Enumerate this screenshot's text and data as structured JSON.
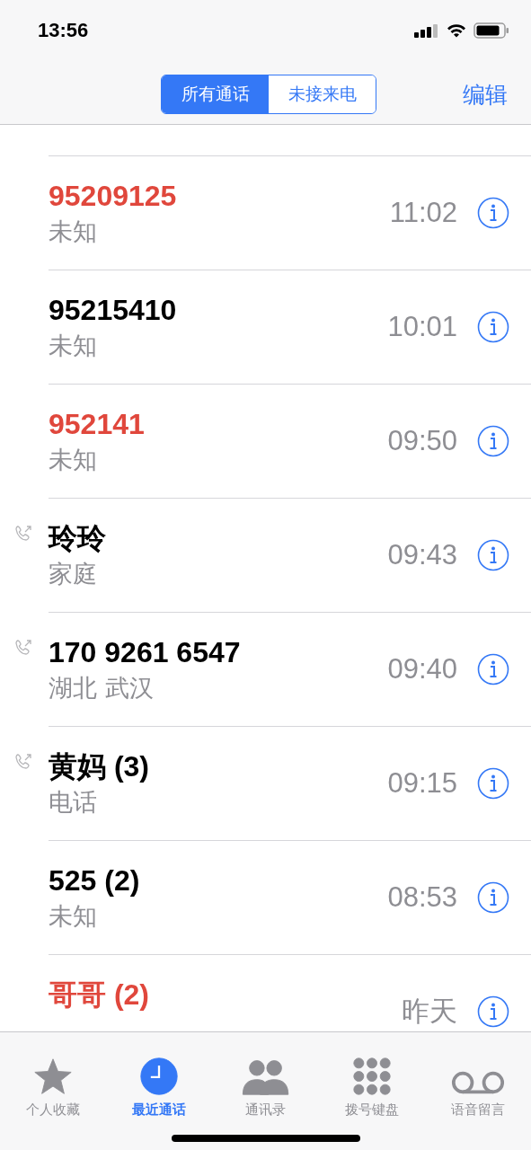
{
  "status_bar": {
    "time": "13:56"
  },
  "nav": {
    "segments": [
      {
        "label": "所有通话",
        "selected": true
      },
      {
        "label": "未接来电",
        "selected": false
      }
    ],
    "edit": "编辑"
  },
  "calls": [
    {
      "name": "95209125",
      "detail": "未知",
      "time": "11:02",
      "missed": true,
      "outgoing": false
    },
    {
      "name": "95215410",
      "detail": "未知",
      "time": "10:01",
      "missed": false,
      "outgoing": false
    },
    {
      "name": "952141",
      "detail": "未知",
      "time": "09:50",
      "missed": true,
      "outgoing": false
    },
    {
      "name": "玲玲",
      "detail": "家庭",
      "time": "09:43",
      "missed": false,
      "outgoing": true
    },
    {
      "name": "170 9261 6547",
      "detail": "湖北 武汉",
      "time": "09:40",
      "missed": false,
      "outgoing": true
    },
    {
      "name": "黄妈 (3)",
      "detail": "电话",
      "time": "09:15",
      "missed": false,
      "outgoing": true
    },
    {
      "name": "525 (2)",
      "detail": "未知",
      "time": "08:53",
      "missed": false,
      "outgoing": false
    },
    {
      "name": "哥哥 (2)",
      "time": "昨天",
      "missed": true,
      "outgoing": false
    }
  ],
  "tab_bar": [
    {
      "kind": "star",
      "label": "个人收藏",
      "selected": false
    },
    {
      "kind": "clock",
      "label": "最近通话",
      "selected": true
    },
    {
      "kind": "people",
      "label": "通讯录",
      "selected": false
    },
    {
      "kind": "keypad",
      "label": "拨号键盘",
      "selected": false
    },
    {
      "kind": "voicemail",
      "label": "语音留言",
      "selected": false
    }
  ]
}
